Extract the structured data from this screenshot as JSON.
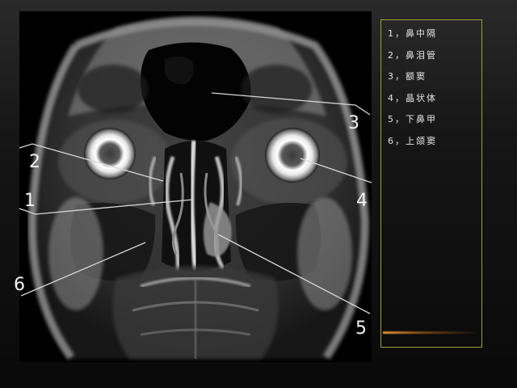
{
  "image": {
    "type": "coronal MRI of orbits and nasal cavity"
  },
  "markers": [
    {
      "id": 1,
      "text": "1"
    },
    {
      "id": 2,
      "text": "2"
    },
    {
      "id": 3,
      "text": "3"
    },
    {
      "id": 4,
      "text": "4"
    },
    {
      "id": 5,
      "text": "5"
    },
    {
      "id": 6,
      "text": "6"
    }
  ],
  "legend": {
    "items": [
      {
        "label": "1，鼻中隔"
      },
      {
        "label": "2，鼻泪管"
      },
      {
        "label": "3，额窦"
      },
      {
        "label": "4，晶状体"
      },
      {
        "label": "5，下鼻甲"
      },
      {
        "label": "6，上颌窦"
      }
    ]
  },
  "colors": {
    "legend_border": "#9aa238",
    "callout_line": "#d8d8d8",
    "accent_streak": "#ff9a3c"
  }
}
